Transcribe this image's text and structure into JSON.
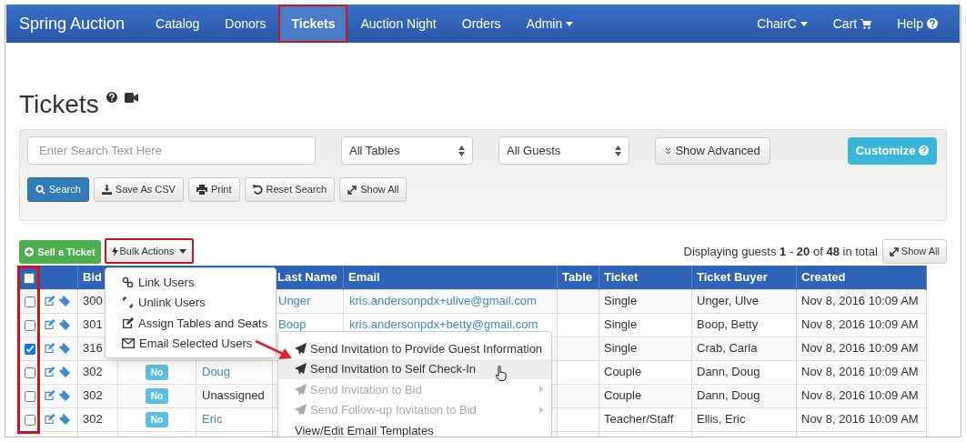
{
  "nav": {
    "brand": "Spring Auction",
    "items": [
      {
        "label": "Catalog",
        "selected": false,
        "dropdown": false,
        "highlighted": false
      },
      {
        "label": "Donors",
        "selected": false,
        "dropdown": false,
        "highlighted": false
      },
      {
        "label": "Tickets",
        "selected": true,
        "dropdown": false,
        "highlighted": true
      },
      {
        "label": "Auction Night",
        "selected": false,
        "dropdown": false,
        "highlighted": false
      },
      {
        "label": "Orders",
        "selected": false,
        "dropdown": false,
        "highlighted": false
      },
      {
        "label": "Admin",
        "selected": false,
        "dropdown": true,
        "highlighted": false
      }
    ],
    "right": [
      {
        "label": "ChairC",
        "kind": "dropdown"
      },
      {
        "label": "Cart",
        "kind": "cart"
      },
      {
        "label": "Help",
        "kind": "help"
      }
    ]
  },
  "page_title": "Tickets",
  "search": {
    "placeholder": "Enter Search Text Here",
    "table_filter": "All Tables",
    "guest_filter": "All Guests",
    "advanced": "Show Advanced",
    "customize": "Customize",
    "buttons": [
      {
        "label": "Search",
        "kind": "search"
      },
      {
        "label": "Save As CSV",
        "kind": "download"
      },
      {
        "label": "Print",
        "kind": "print"
      },
      {
        "label": "Reset Search",
        "kind": "reset"
      },
      {
        "label": "Show All",
        "kind": "expand"
      }
    ]
  },
  "actions": {
    "sell": "Sell a Ticket",
    "bulk": "Bulk Actions",
    "bulk_highlighted": true,
    "summary": "Displaying guests **1** - **20** of **48** in total",
    "show_all": "Show All"
  },
  "table": {
    "select_all_checked": false,
    "select_column_highlighted": true,
    "columns": [
      {
        "kind": "select"
      },
      {
        "kind": "actions"
      },
      {
        "kind": "text",
        "label": "Bid"
      },
      {
        "kind": "blank"
      },
      {
        "kind": "blank"
      },
      {
        "kind": "text",
        "label": "Last Name"
      },
      {
        "kind": "text",
        "label": "Email"
      },
      {
        "kind": "text",
        "label": "Table"
      },
      {
        "kind": "text",
        "label": "Ticket"
      },
      {
        "kind": "text",
        "label": "Ticket Buyer"
      },
      {
        "kind": "text",
        "label": "Created"
      }
    ],
    "rows": [
      {
        "checked": false,
        "bid": "300",
        "last_name": "Unger",
        "email": "kris.andersonpdx+ulive@gmail.com",
        "ticket": "Single",
        "buyer": "Unger, Ulve",
        "created": "Nov 8, 2016 10:09 AM"
      },
      {
        "checked": false,
        "bid": "301",
        "last_name": "Boop",
        "email": "kris.andersonpdx+betty@gmail.com",
        "ticket": "Single",
        "buyer": "Boop, Betty",
        "created": "Nov 8, 2016 10:09 AM"
      },
      {
        "checked": true,
        "bid": "316",
        "ticket": "Single",
        "buyer": "Crab, Carla",
        "created": "Nov 8, 2016 10:09 AM"
      },
      {
        "checked": false,
        "bid": "302",
        "paid": "No",
        "first_name": {
          "text": "Doug",
          "link": true
        },
        "ticket": "Couple",
        "buyer": "Dann, Doug",
        "created": "Nov 8, 2016 10:09 AM"
      },
      {
        "checked": false,
        "bid": "302",
        "paid": "No",
        "first_name": {
          "text": "Unassigned",
          "link": false
        },
        "ticket": "Couple",
        "buyer": "Dann, Doug",
        "created": "Nov 8, 2016 10:09 AM"
      },
      {
        "checked": false,
        "bid": "302",
        "paid": "No",
        "first_name": {
          "text": "Eric",
          "link": true
        },
        "ticket": "Teacher/Staff",
        "buyer": "Ellis, Eric",
        "created": "Nov 8, 2016 10:09 AM"
      }
    ]
  },
  "bulk_menu": {
    "arrow": true,
    "items": [
      {
        "kind": "link",
        "label": "Link Users"
      },
      {
        "kind": "unlink",
        "label": "Unlink Users"
      },
      {
        "kind": "edit",
        "label": "Assign Tables and Seats"
      },
      {
        "kind": "envelope",
        "label": "Email Selected Users"
      }
    ],
    "submenu": [
      {
        "kind": "plane",
        "label": "Send Invitation to Provide Guest Information",
        "selected": false,
        "disabled": false,
        "submenu": false
      },
      {
        "kind": "plane",
        "label": "Send Invitation to Self Check-In",
        "selected": true,
        "disabled": false,
        "submenu": false
      },
      {
        "kind": "plane",
        "label": "Send Invitation to Bid",
        "selected": false,
        "disabled": true,
        "submenu": true
      },
      {
        "kind": "plane",
        "label": "Send Follow-up Invitation to Bid",
        "selected": false,
        "disabled": true,
        "submenu": true
      },
      {
        "kind": "plain",
        "label": "View/Edit Email Templates",
        "selected": false,
        "disabled": false,
        "submenu": false
      }
    ]
  }
}
